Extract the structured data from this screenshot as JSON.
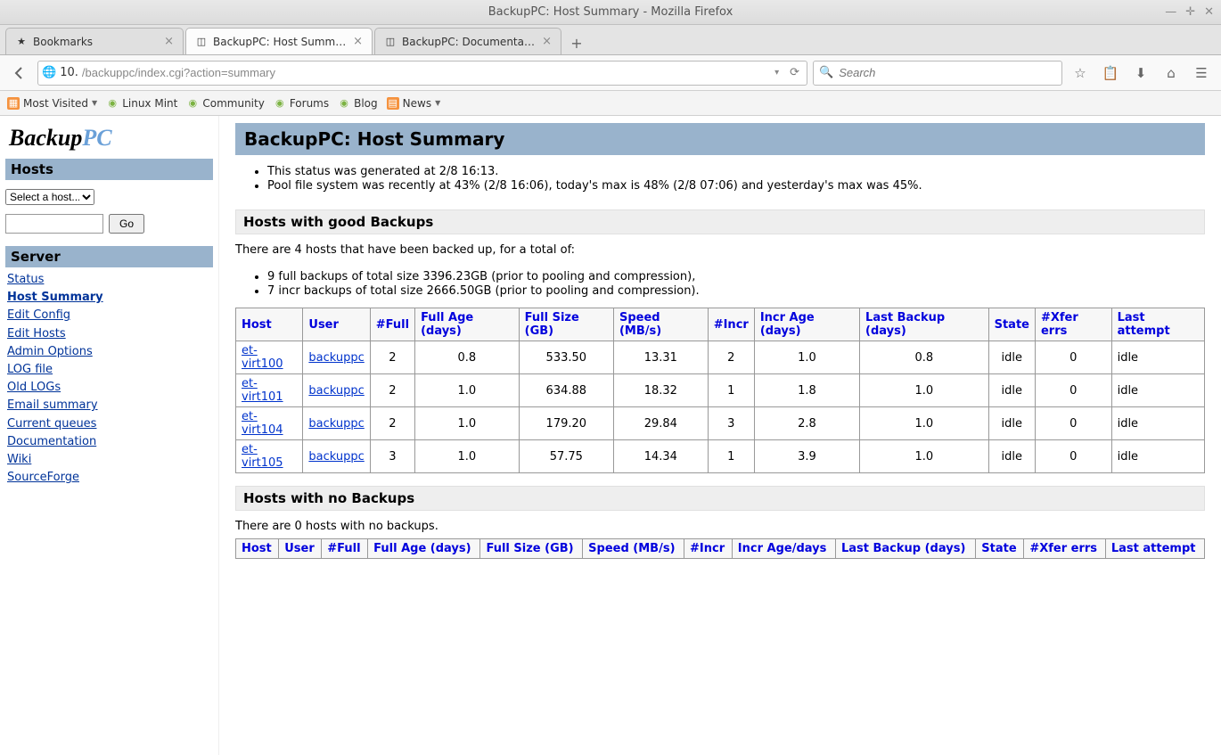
{
  "window_title": "BackupPC: Host Summary - Mozilla Firefox",
  "tabs": [
    {
      "label": "Bookmarks",
      "fav": "star"
    },
    {
      "label": "BackupPC: Host Summary",
      "fav": "page",
      "active": true
    },
    {
      "label": "BackupPC: Documentation",
      "fav": "page"
    }
  ],
  "url_prefix": "10.",
  "url_suffix": "/backuppc/index.cgi?action=summary",
  "search_placeholder": "Search",
  "bookmarks": [
    {
      "label": "Most Visited",
      "ico": "orange",
      "dd": true
    },
    {
      "label": "Linux Mint",
      "ico": "green"
    },
    {
      "label": "Community",
      "ico": "green"
    },
    {
      "label": "Forums",
      "ico": "green"
    },
    {
      "label": "Blog",
      "ico": "green"
    },
    {
      "label": "News",
      "ico": "rss",
      "dd": true
    }
  ],
  "logo": {
    "t1": "Backup",
    "t2": "PC"
  },
  "side_hosts_hdr": "Hosts",
  "host_select": "Select a host...",
  "go_btn": "Go",
  "side_server_hdr": "Server",
  "navlinks": [
    {
      "label": "Status"
    },
    {
      "label": "Host Summary",
      "cur": true
    },
    {
      "label": "Edit Config"
    },
    {
      "label": "Edit Hosts"
    },
    {
      "label": "Admin Options"
    },
    {
      "label": "LOG file"
    },
    {
      "label": "Old LOGs"
    },
    {
      "label": "Email summary"
    },
    {
      "label": "Current queues"
    },
    {
      "label": "Documentation"
    },
    {
      "label": "Wiki"
    },
    {
      "label": "SourceForge"
    }
  ],
  "page_title": "BackupPC: Host Summary",
  "status_bullets": [
    "This status was generated at 2/8 16:13.",
    "Pool file system was recently at 43% (2/8 16:06), today's max is 48% (2/8 07:06) and yesterday's max was 45%."
  ],
  "good_hdr": "Hosts with good Backups",
  "good_intro": "There are 4 hosts that have been backed up, for a total of:",
  "good_bullets": [
    "9 full backups of total size 3396.23GB (prior to pooling and compression),",
    "7 incr backups of total size 2666.50GB (prior to pooling and compression)."
  ],
  "cols": [
    "Host",
    "User",
    "#Full",
    "Full Age (days)",
    "Full Size (GB)",
    "Speed (MB/s)",
    "#Incr",
    "Incr Age (days)",
    "Last Backup (days)",
    "State",
    "#Xfer errs",
    "Last attempt"
  ],
  "rows": [
    {
      "host": "et-virt100",
      "user": "backuppc",
      "full": "2",
      "fage": "0.8",
      "fsize": "533.50",
      "speed": "13.31",
      "incr": "2",
      "iage": "1.0",
      "last": "0.8",
      "state": "idle",
      "xfer": "0",
      "attempt": "idle"
    },
    {
      "host": "et-virt101",
      "user": "backuppc",
      "full": "2",
      "fage": "1.0",
      "fsize": "634.88",
      "speed": "18.32",
      "incr": "1",
      "iage": "1.8",
      "last": "1.0",
      "state": "idle",
      "xfer": "0",
      "attempt": "idle"
    },
    {
      "host": "et-virt104",
      "user": "backuppc",
      "full": "2",
      "fage": "1.0",
      "fsize": "179.20",
      "speed": "29.84",
      "incr": "3",
      "iage": "2.8",
      "last": "1.0",
      "state": "idle",
      "xfer": "0",
      "attempt": "idle"
    },
    {
      "host": "et-virt105",
      "user": "backuppc",
      "full": "3",
      "fage": "1.0",
      "fsize": "57.75",
      "speed": "14.34",
      "incr": "1",
      "iage": "3.9",
      "last": "1.0",
      "state": "idle",
      "xfer": "0",
      "attempt": "idle"
    }
  ],
  "none_hdr": "Hosts with no Backups",
  "none_intro": "There are 0 hosts with no backups.",
  "cols2": [
    "Host",
    "User",
    "#Full",
    "Full Age (days)",
    "Full Size (GB)",
    "Speed (MB/s)",
    "#Incr",
    "Incr Age/days",
    "Last Backup (days)",
    "State",
    "#Xfer errs",
    "Last attempt"
  ]
}
